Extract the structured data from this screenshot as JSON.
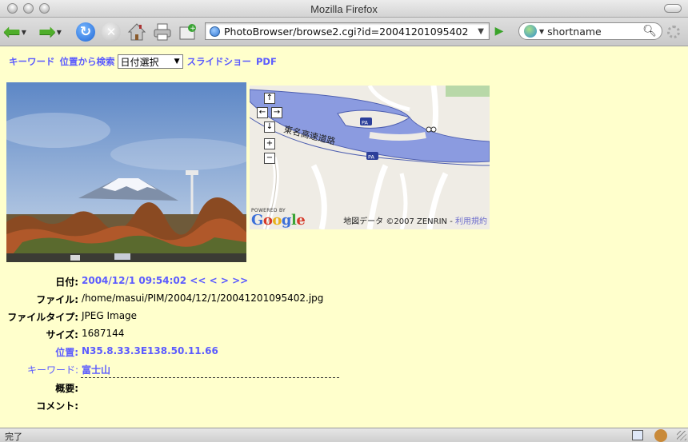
{
  "window": {
    "title": "Mozilla Firefox"
  },
  "toolbar": {
    "url": "PhotoBrowser/browse2.cgi?id=20041201095402",
    "search_value": "shortname"
  },
  "nav": {
    "keyword": "キーワード",
    "location_search": "位置から検索",
    "date_select": "日付選択",
    "slideshow": "スライドショー",
    "pdf": "PDF"
  },
  "map": {
    "copyright": "地図データ ©2007 ZENRIN -",
    "terms": "利用規約",
    "road_label": "東名高速道路",
    "pa1": "PA",
    "pa2": "PA",
    "powered_by": "POWERED BY",
    "google_letters": [
      "G",
      "o",
      "o",
      "g",
      "l",
      "e"
    ],
    "google_colors": [
      "#3b6fd9",
      "#d63a2a",
      "#e8b21a",
      "#3b6fd9",
      "#3aa334",
      "#d63a2a"
    ]
  },
  "info": {
    "date_label": "日付:",
    "date_value": "2004/12/1 09:54:02",
    "nav_prev_prev": "<<",
    "nav_prev": "<",
    "nav_next": ">",
    "nav_next_next": ">>",
    "file_label": "ファイル:",
    "file_value": "/home/masui/PIM/2004/12/1/20041201095402.jpg",
    "filetype_label": "ファイルタイプ:",
    "filetype_value": "JPEG Image",
    "size_label": "サイズ:",
    "size_value": "1687144",
    "position_label": "位置:",
    "position_value": "N35.8.33.3E138.50.11.66",
    "keyword_label": "キーワード:",
    "keyword_value": "富士山",
    "summary_label": "概要:",
    "comment_label": "コメント:"
  },
  "status": {
    "text": "完了"
  },
  "colors": {
    "content_bg": "#ffffcc",
    "link": "#5b5bff"
  }
}
